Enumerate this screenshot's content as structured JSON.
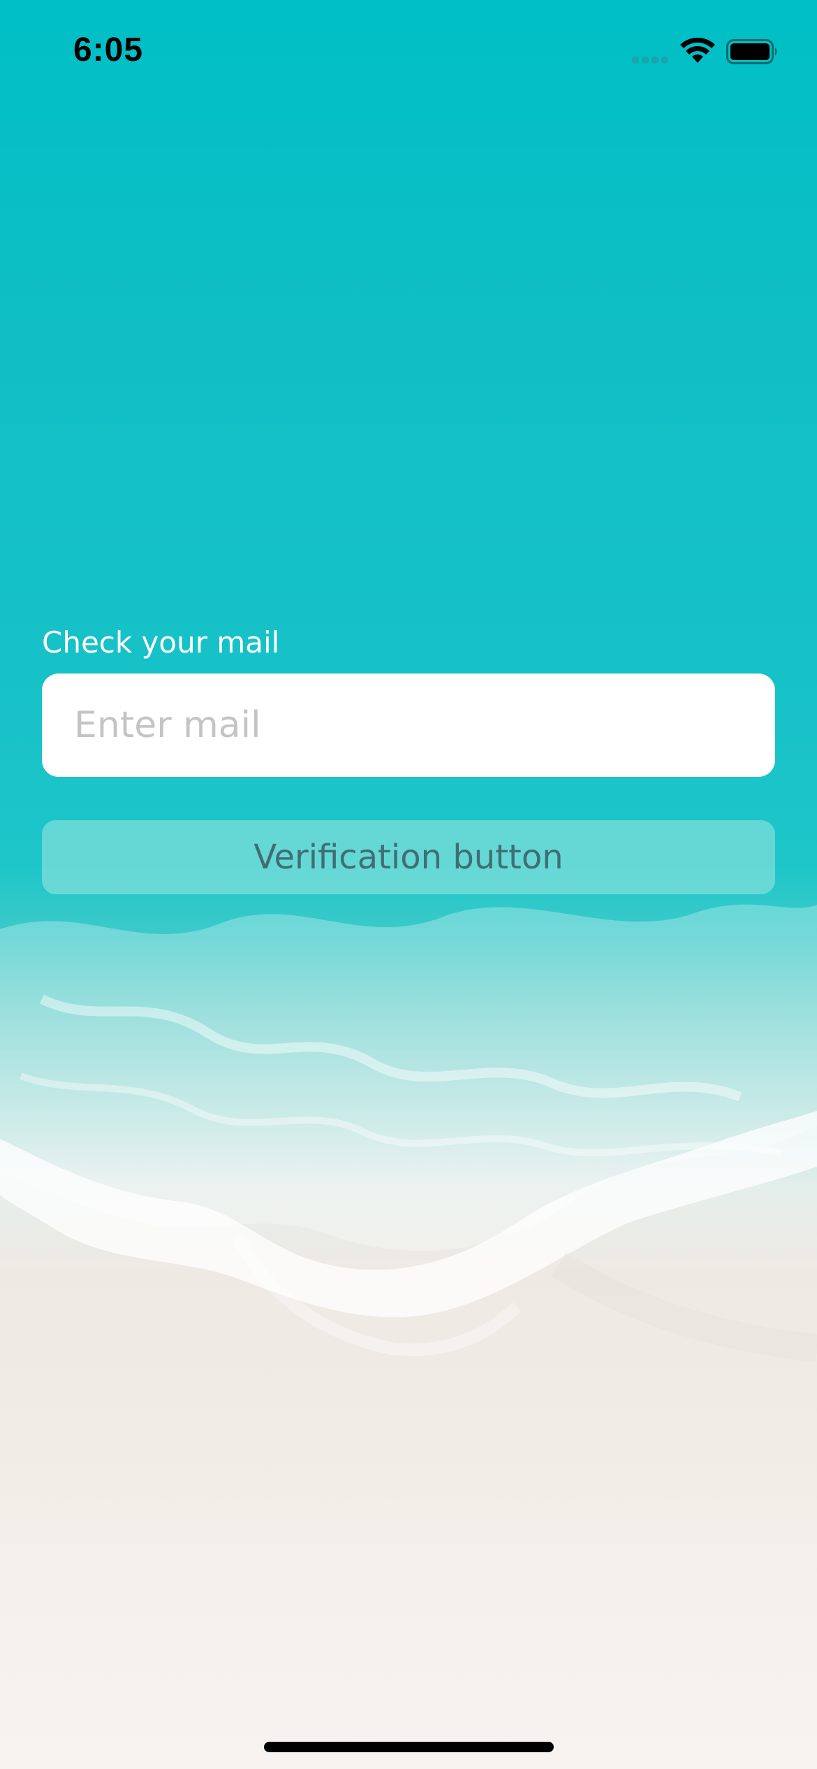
{
  "status_bar": {
    "time": "6:05",
    "icons": [
      "cellular-signal-icon",
      "wifi-icon",
      "battery-icon"
    ]
  },
  "form": {
    "label": "Check your mail",
    "email_input": {
      "value": "",
      "placeholder": "Enter mail"
    },
    "verify_button_label": "Verification button"
  },
  "colors": {
    "sea": "#00bfc6",
    "sand": "#f2ece6",
    "input_background": "#ffffff",
    "button_background": "#a0e8de",
    "button_text": "#3f6e74"
  }
}
